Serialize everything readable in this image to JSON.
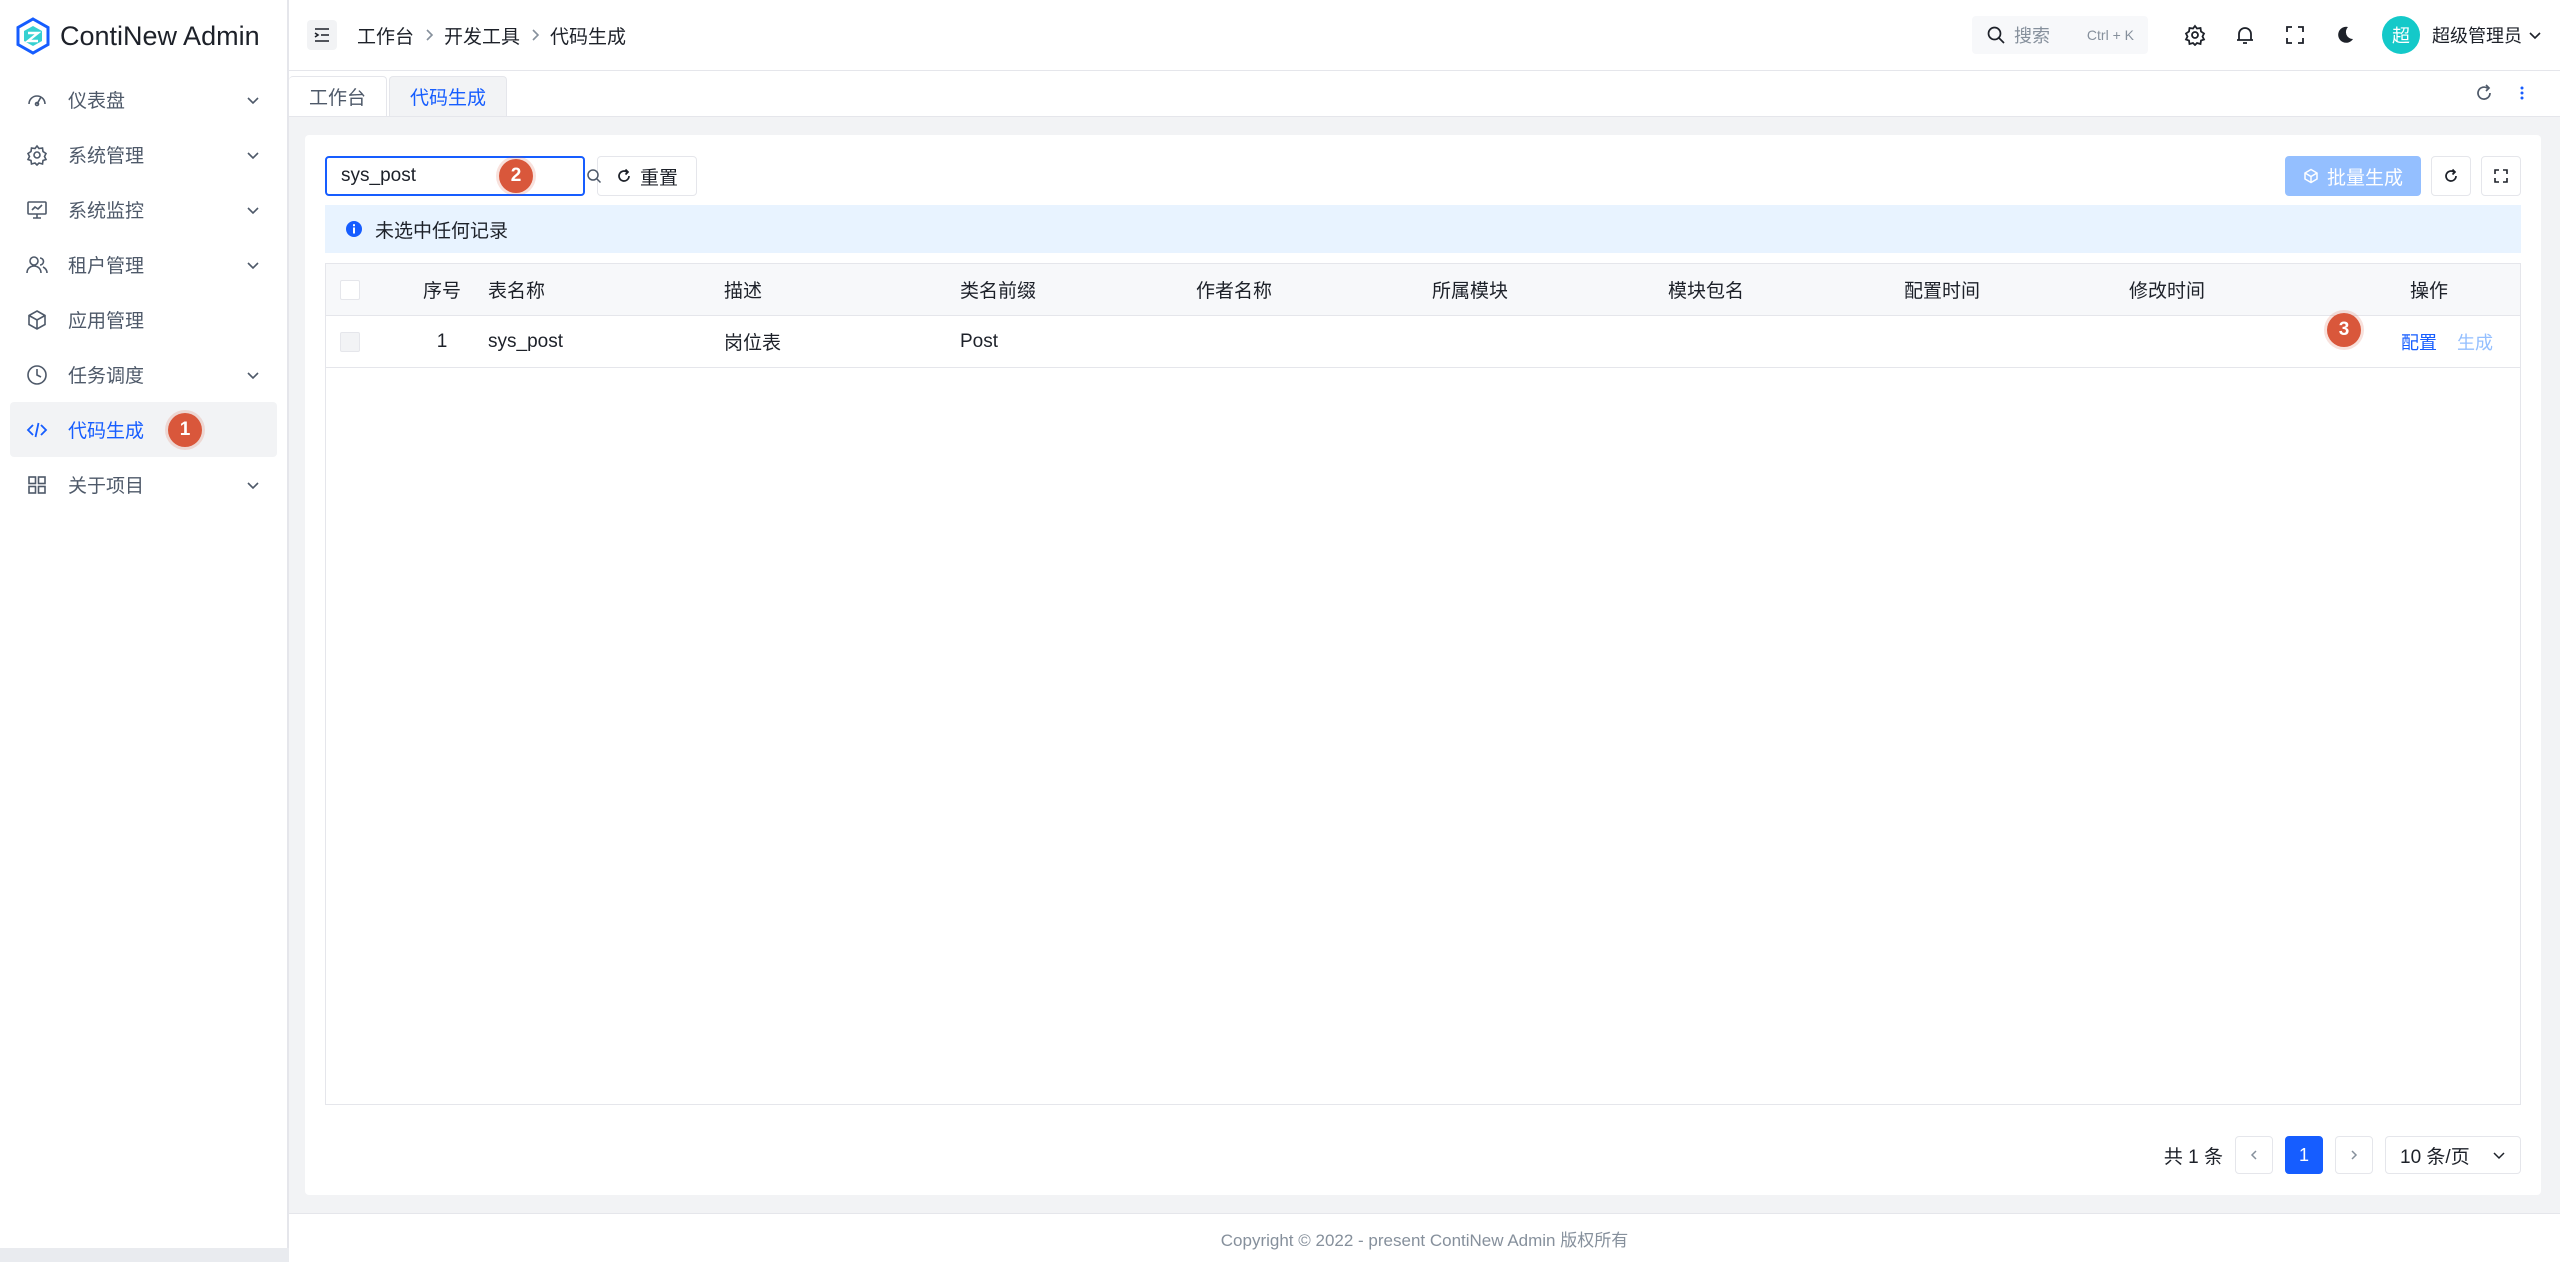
{
  "app": {
    "name": "ContiNew Admin"
  },
  "sidebar": {
    "items": [
      {
        "label": "仪表盘",
        "icon": "dashboard-icon",
        "expandable": true
      },
      {
        "label": "系统管理",
        "icon": "gear-icon",
        "expandable": true
      },
      {
        "label": "系统监控",
        "icon": "monitor-icon",
        "expandable": true
      },
      {
        "label": "租户管理",
        "icon": "users-icon",
        "expandable": true
      },
      {
        "label": "应用管理",
        "icon": "cube-icon",
        "expandable": false
      },
      {
        "label": "任务调度",
        "icon": "clock-icon",
        "expandable": true
      },
      {
        "label": "代码生成",
        "icon": "code-icon",
        "expandable": false,
        "active": true
      },
      {
        "label": "关于项目",
        "icon": "apps-icon",
        "expandable": true
      }
    ]
  },
  "header": {
    "breadcrumb": [
      "工作台",
      "开发工具",
      "代码生成"
    ],
    "search": {
      "placeholder": "搜索",
      "shortcut": "Ctrl + K"
    },
    "user": {
      "avatar_text": "超",
      "name": "超级管理员"
    }
  },
  "tabs": [
    {
      "label": "工作台",
      "active": false
    },
    {
      "label": "代码生成",
      "active": true
    }
  ],
  "toolbar": {
    "search_value": "sys_post",
    "reset_label": "重置",
    "batch_label": "批量生成"
  },
  "alert": {
    "text": "未选中任何记录"
  },
  "table": {
    "columns": [
      "序号",
      "表名称",
      "描述",
      "类名前缀",
      "作者名称",
      "所属模块",
      "模块包名",
      "配置时间",
      "修改时间",
      "操作"
    ],
    "rows": [
      {
        "index": "1",
        "table_name": "sys_post",
        "description": "岗位表",
        "class_prefix": "Post",
        "author": "",
        "module": "",
        "package": "",
        "config_time": "",
        "update_time": "",
        "actions": [
          "配置",
          "生成"
        ]
      }
    ]
  },
  "pagination": {
    "total_text": "共 1 条",
    "current_page": "1",
    "page_size": "10 条/页"
  },
  "steps": {
    "step1": "1",
    "step2": "2",
    "step3": "3"
  },
  "footer": {
    "copyright": "Copyright © 2022 - present ContiNew Admin 版权所有"
  },
  "colors": {
    "primary": "#165dff",
    "primary_light": "#94bfff",
    "badge": "#d9573b",
    "avatar": "#14c9c9",
    "alert_bg": "#e8f3ff"
  }
}
